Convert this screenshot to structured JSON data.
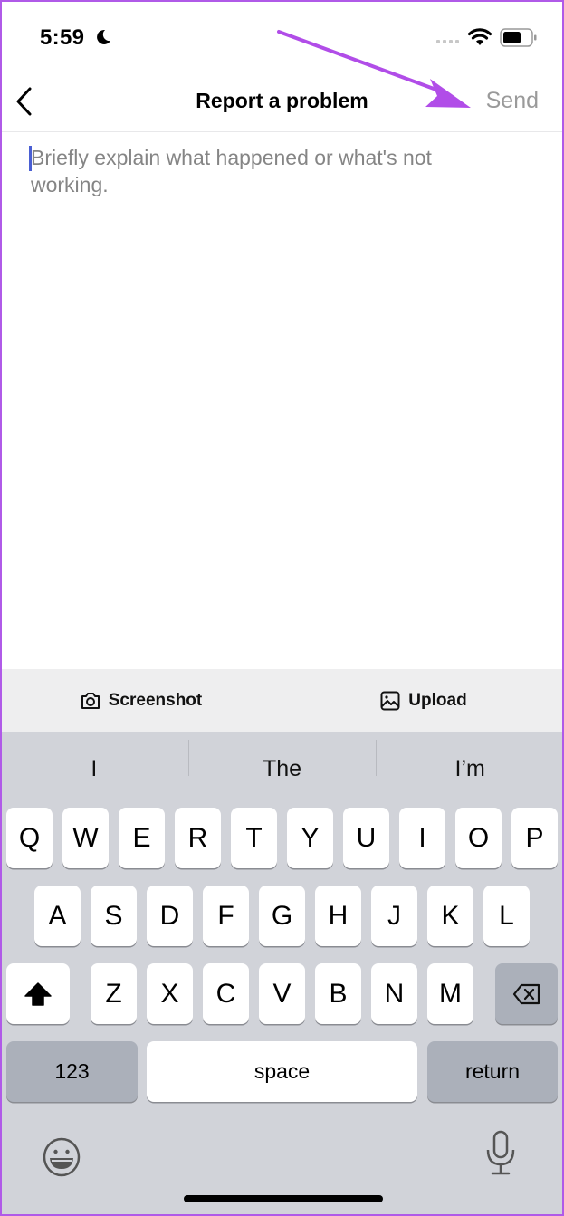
{
  "status_bar": {
    "time": "5:59",
    "focus_icon": "moon-icon",
    "wifi_icon": "wifi-icon",
    "battery_icon": "battery-icon"
  },
  "nav": {
    "back_icon": "chevron-left-icon",
    "title": "Report a problem",
    "send_label": "Send"
  },
  "form": {
    "placeholder": "Briefly explain what happened or what's not working.",
    "value": ""
  },
  "attachments": {
    "screenshot_label": "Screenshot",
    "screenshot_icon": "camera-icon",
    "upload_label": "Upload",
    "upload_icon": "image-icon"
  },
  "keyboard": {
    "suggestions": [
      "I",
      "The",
      "I’m"
    ],
    "row1": [
      "Q",
      "W",
      "E",
      "R",
      "T",
      "Y",
      "U",
      "I",
      "O",
      "P"
    ],
    "row2": [
      "A",
      "S",
      "D",
      "F",
      "G",
      "H",
      "J",
      "K",
      "L"
    ],
    "row3": [
      "Z",
      "X",
      "C",
      "V",
      "B",
      "N",
      "M"
    ],
    "numbers_label": "123",
    "space_label": "space",
    "return_label": "return",
    "shift_icon": "shift-icon",
    "delete_icon": "backspace-icon",
    "emoji_icon": "emoji-icon",
    "mic_icon": "microphone-icon"
  },
  "annotation": {
    "arrow_color": "#b14de8",
    "points_to": "Send"
  }
}
